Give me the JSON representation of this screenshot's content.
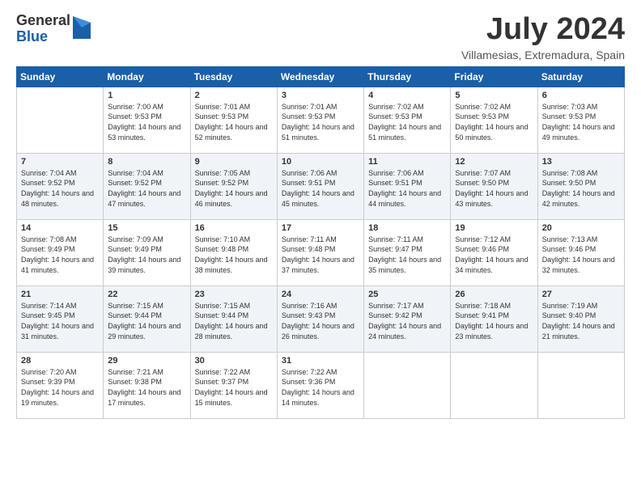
{
  "logo": {
    "general": "General",
    "blue": "Blue"
  },
  "title": "July 2024",
  "subtitle": "Villamesias, Extremadura, Spain",
  "days_of_week": [
    "Sunday",
    "Monday",
    "Tuesday",
    "Wednesday",
    "Thursday",
    "Friday",
    "Saturday"
  ],
  "weeks": [
    [
      {
        "day": "",
        "sunrise": "",
        "sunset": "",
        "daylight": ""
      },
      {
        "day": "1",
        "sunrise": "Sunrise: 7:00 AM",
        "sunset": "Sunset: 9:53 PM",
        "daylight": "Daylight: 14 hours and 53 minutes."
      },
      {
        "day": "2",
        "sunrise": "Sunrise: 7:01 AM",
        "sunset": "Sunset: 9:53 PM",
        "daylight": "Daylight: 14 hours and 52 minutes."
      },
      {
        "day": "3",
        "sunrise": "Sunrise: 7:01 AM",
        "sunset": "Sunset: 9:53 PM",
        "daylight": "Daylight: 14 hours and 51 minutes."
      },
      {
        "day": "4",
        "sunrise": "Sunrise: 7:02 AM",
        "sunset": "Sunset: 9:53 PM",
        "daylight": "Daylight: 14 hours and 51 minutes."
      },
      {
        "day": "5",
        "sunrise": "Sunrise: 7:02 AM",
        "sunset": "Sunset: 9:53 PM",
        "daylight": "Daylight: 14 hours and 50 minutes."
      },
      {
        "day": "6",
        "sunrise": "Sunrise: 7:03 AM",
        "sunset": "Sunset: 9:53 PM",
        "daylight": "Daylight: 14 hours and 49 minutes."
      }
    ],
    [
      {
        "day": "7",
        "sunrise": "Sunrise: 7:04 AM",
        "sunset": "Sunset: 9:52 PM",
        "daylight": "Daylight: 14 hours and 48 minutes."
      },
      {
        "day": "8",
        "sunrise": "Sunrise: 7:04 AM",
        "sunset": "Sunset: 9:52 PM",
        "daylight": "Daylight: 14 hours and 47 minutes."
      },
      {
        "day": "9",
        "sunrise": "Sunrise: 7:05 AM",
        "sunset": "Sunset: 9:52 PM",
        "daylight": "Daylight: 14 hours and 46 minutes."
      },
      {
        "day": "10",
        "sunrise": "Sunrise: 7:06 AM",
        "sunset": "Sunset: 9:51 PM",
        "daylight": "Daylight: 14 hours and 45 minutes."
      },
      {
        "day": "11",
        "sunrise": "Sunrise: 7:06 AM",
        "sunset": "Sunset: 9:51 PM",
        "daylight": "Daylight: 14 hours and 44 minutes."
      },
      {
        "day": "12",
        "sunrise": "Sunrise: 7:07 AM",
        "sunset": "Sunset: 9:50 PM",
        "daylight": "Daylight: 14 hours and 43 minutes."
      },
      {
        "day": "13",
        "sunrise": "Sunrise: 7:08 AM",
        "sunset": "Sunset: 9:50 PM",
        "daylight": "Daylight: 14 hours and 42 minutes."
      }
    ],
    [
      {
        "day": "14",
        "sunrise": "Sunrise: 7:08 AM",
        "sunset": "Sunset: 9:49 PM",
        "daylight": "Daylight: 14 hours and 41 minutes."
      },
      {
        "day": "15",
        "sunrise": "Sunrise: 7:09 AM",
        "sunset": "Sunset: 9:49 PM",
        "daylight": "Daylight: 14 hours and 39 minutes."
      },
      {
        "day": "16",
        "sunrise": "Sunrise: 7:10 AM",
        "sunset": "Sunset: 9:48 PM",
        "daylight": "Daylight: 14 hours and 38 minutes."
      },
      {
        "day": "17",
        "sunrise": "Sunrise: 7:11 AM",
        "sunset": "Sunset: 9:48 PM",
        "daylight": "Daylight: 14 hours and 37 minutes."
      },
      {
        "day": "18",
        "sunrise": "Sunrise: 7:11 AM",
        "sunset": "Sunset: 9:47 PM",
        "daylight": "Daylight: 14 hours and 35 minutes."
      },
      {
        "day": "19",
        "sunrise": "Sunrise: 7:12 AM",
        "sunset": "Sunset: 9:46 PM",
        "daylight": "Daylight: 14 hours and 34 minutes."
      },
      {
        "day": "20",
        "sunrise": "Sunrise: 7:13 AM",
        "sunset": "Sunset: 9:46 PM",
        "daylight": "Daylight: 14 hours and 32 minutes."
      }
    ],
    [
      {
        "day": "21",
        "sunrise": "Sunrise: 7:14 AM",
        "sunset": "Sunset: 9:45 PM",
        "daylight": "Daylight: 14 hours and 31 minutes."
      },
      {
        "day": "22",
        "sunrise": "Sunrise: 7:15 AM",
        "sunset": "Sunset: 9:44 PM",
        "daylight": "Daylight: 14 hours and 29 minutes."
      },
      {
        "day": "23",
        "sunrise": "Sunrise: 7:15 AM",
        "sunset": "Sunset: 9:44 PM",
        "daylight": "Daylight: 14 hours and 28 minutes."
      },
      {
        "day": "24",
        "sunrise": "Sunrise: 7:16 AM",
        "sunset": "Sunset: 9:43 PM",
        "daylight": "Daylight: 14 hours and 26 minutes."
      },
      {
        "day": "25",
        "sunrise": "Sunrise: 7:17 AM",
        "sunset": "Sunset: 9:42 PM",
        "daylight": "Daylight: 14 hours and 24 minutes."
      },
      {
        "day": "26",
        "sunrise": "Sunrise: 7:18 AM",
        "sunset": "Sunset: 9:41 PM",
        "daylight": "Daylight: 14 hours and 23 minutes."
      },
      {
        "day": "27",
        "sunrise": "Sunrise: 7:19 AM",
        "sunset": "Sunset: 9:40 PM",
        "daylight": "Daylight: 14 hours and 21 minutes."
      }
    ],
    [
      {
        "day": "28",
        "sunrise": "Sunrise: 7:20 AM",
        "sunset": "Sunset: 9:39 PM",
        "daylight": "Daylight: 14 hours and 19 minutes."
      },
      {
        "day": "29",
        "sunrise": "Sunrise: 7:21 AM",
        "sunset": "Sunset: 9:38 PM",
        "daylight": "Daylight: 14 hours and 17 minutes."
      },
      {
        "day": "30",
        "sunrise": "Sunrise: 7:22 AM",
        "sunset": "Sunset: 9:37 PM",
        "daylight": "Daylight: 14 hours and 15 minutes."
      },
      {
        "day": "31",
        "sunrise": "Sunrise: 7:22 AM",
        "sunset": "Sunset: 9:36 PM",
        "daylight": "Daylight: 14 hours and 14 minutes."
      },
      {
        "day": "",
        "sunrise": "",
        "sunset": "",
        "daylight": ""
      },
      {
        "day": "",
        "sunrise": "",
        "sunset": "",
        "daylight": ""
      },
      {
        "day": "",
        "sunrise": "",
        "sunset": "",
        "daylight": ""
      }
    ]
  ]
}
